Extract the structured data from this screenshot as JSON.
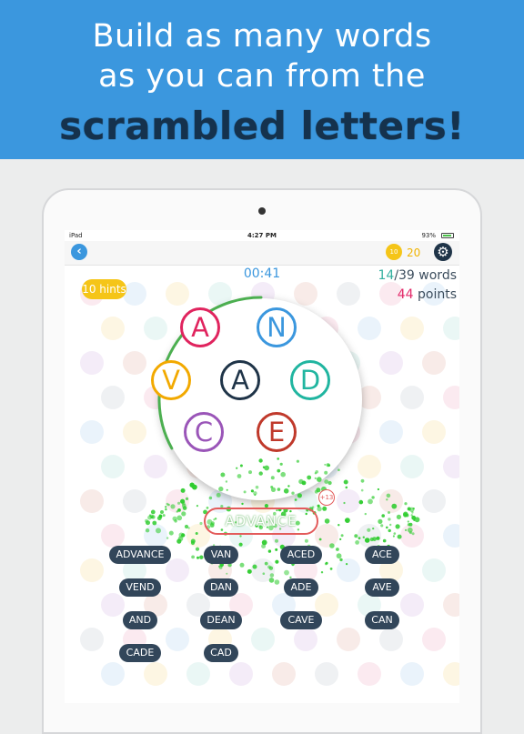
{
  "banner": {
    "line1": "Build as many words",
    "line2": "as you can from the",
    "line3": "scrambled letters!"
  },
  "status_bar": {
    "carrier": "iPad",
    "time": "4:27 PM",
    "battery_pct": "93%",
    "battery_level": 0.93
  },
  "toolbar": {
    "back_icon": "chevron-left-icon",
    "coin_label": "10",
    "coin_count": "20",
    "settings_icon": "gear-icon"
  },
  "game": {
    "timer": "00:41",
    "hints": "10 hints",
    "words_found": "14",
    "words_total": "/39 words",
    "points": "44",
    "points_label": " points",
    "timer_progress": 0.33,
    "letters": [
      {
        "char": "A",
        "color": "#e0245e"
      },
      {
        "char": "N",
        "color": "#3b97de"
      },
      {
        "char": "V",
        "color": "#f2a900"
      },
      {
        "char": "A",
        "color": "#1f3448"
      },
      {
        "char": "D",
        "color": "#20b5a0"
      },
      {
        "char": "C",
        "color": "#9a55b8"
      },
      {
        "char": "E",
        "color": "#c0392b"
      }
    ],
    "last_word": "ADVANCE",
    "last_score": "+13",
    "found_words": [
      "ADVANCE",
      "VAN",
      "ACED",
      "ACE",
      "VEND",
      "DAN",
      "ADE",
      "AVE",
      "AND",
      "DEAN",
      "CAVE",
      "CAN",
      "CADE",
      "CAD"
    ]
  },
  "colors": {
    "banner": "#3b97de",
    "timer_ring": "#4caf50",
    "chip": "#32465a",
    "particle": "#2ecc2e"
  }
}
